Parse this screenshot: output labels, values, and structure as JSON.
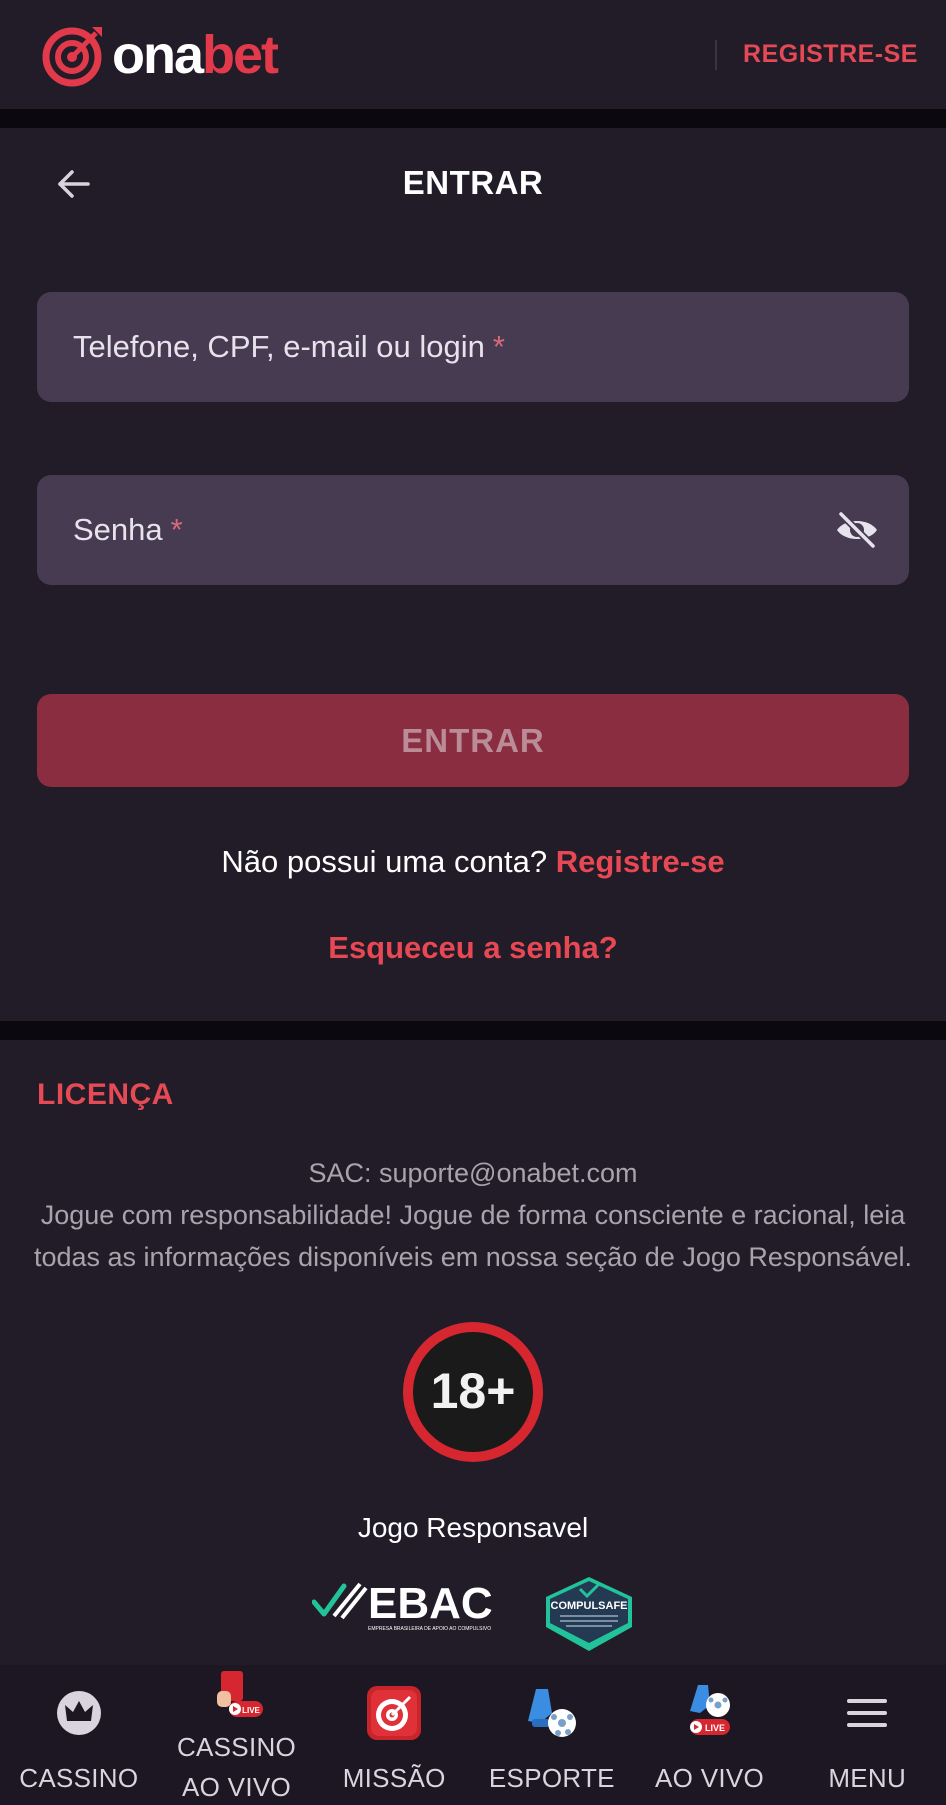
{
  "header": {
    "logo_part1": "ona",
    "logo_part2": "bet",
    "register_label": "REGISTRE-SE"
  },
  "login": {
    "title": "ENTRAR",
    "user_placeholder": "Telefone, CPF, e-mail ou login",
    "password_placeholder": "Senha",
    "required_mark": "*",
    "submit_label": "ENTRAR",
    "no_account_text": "Não possui uma conta?",
    "register_link": "Registre-se",
    "forgot_link": "Esqueceu a senha?"
  },
  "license": {
    "title": "LICENÇA",
    "sac": "SAC: suporte@onabet.com",
    "message": "Jogue com responsabilidade! Jogue de forma consciente e racional, leia todas as informações disponíveis em nossa seção de Jogo Responsável.",
    "age_badge": "18+",
    "responsible_label": "Jogo Responsavel",
    "ebac_text": "EBAC",
    "ebac_subtext": "EMPRESA BRASILEIRA DE APOIO AO COMPULSIVO",
    "compulsafe_text": "COMPULSAFE"
  },
  "bottom_nav": [
    {
      "label": "CASSINO",
      "icon": "crown-icon"
    },
    {
      "label_line1": "CASSINO",
      "label_line2": "AO VIVO",
      "icon": "live-casino-icon",
      "badge": "LIVE"
    },
    {
      "label": "MISSÃO",
      "icon": "target-icon"
    },
    {
      "label": "ESPORTE",
      "icon": "soccer-icon"
    },
    {
      "label": "AO VIVO",
      "icon": "live-soccer-icon",
      "badge": "LIVE"
    },
    {
      "label": "MENU",
      "icon": "hamburger-icon"
    }
  ],
  "colors": {
    "accent": "#e54955",
    "panel": "#211c27",
    "field": "#463b51",
    "button": "#8a2d40"
  }
}
